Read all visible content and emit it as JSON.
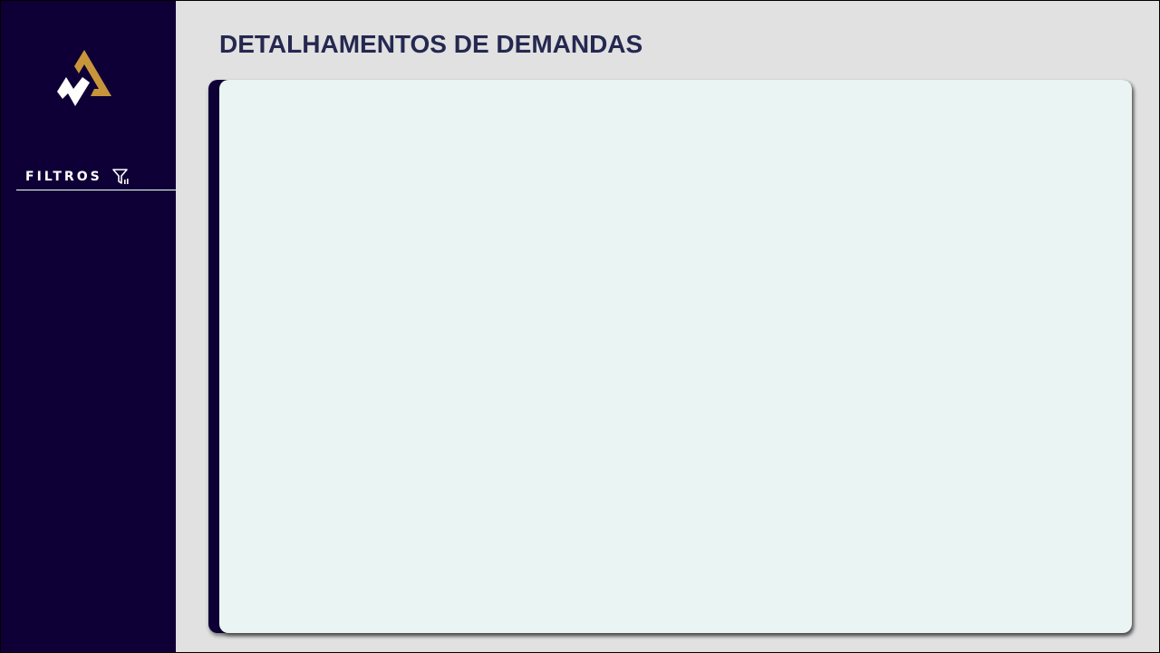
{
  "sidebar": {
    "logo_icon": "brand-logo-mountain-icon",
    "filters_label": "FILTROS",
    "filters_icon": "filter-settings-icon"
  },
  "main": {
    "title": "DETALHAMENTOS DE DEMANDAS"
  },
  "colors": {
    "sidebar_bg": "#0e0036",
    "page_bg": "#e0e1e0",
    "title": "#252850",
    "panel_bg": "#eaf4f2",
    "logo_gold": "#c8963a",
    "logo_white": "#ffffff"
  }
}
